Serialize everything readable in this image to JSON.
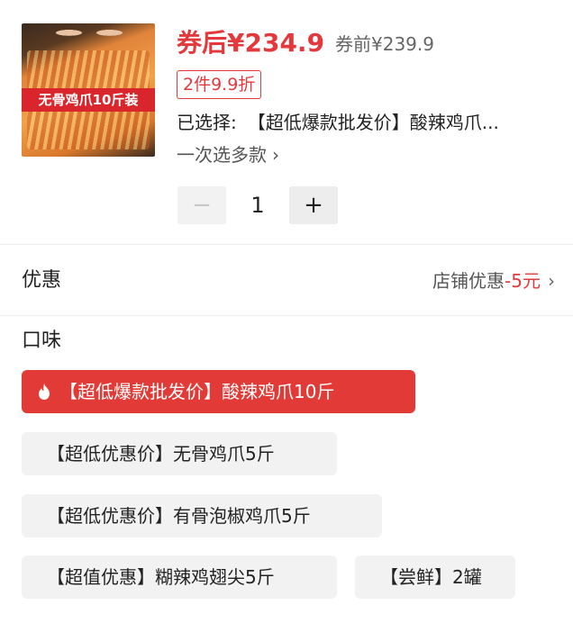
{
  "product": {
    "image_caption": "无骨鸡爪10斤装",
    "price_after": "券后¥234.9",
    "price_before": "券前¥239.9",
    "promo_tag": "2件9.9折",
    "selected_label": "已选择:",
    "selected_value": "【超低爆款批发价】酸辣鸡爪...",
    "multi_select": "一次选多款",
    "multi_chevron": "›"
  },
  "quantity": {
    "minus": "−",
    "value": "1",
    "plus": "+"
  },
  "discount": {
    "label": "优惠",
    "store_label": "店铺优惠",
    "amount": "-5元",
    "chevron": "›"
  },
  "flavor": {
    "label": "口味",
    "options": [
      {
        "label": "【超低爆款批发价】酸辣鸡爪10斤",
        "selected": true
      },
      {
        "label": "【超低优惠价】无骨鸡爪5斤",
        "selected": false
      },
      {
        "label": "【超低优惠价】有骨泡椒鸡爪5斤",
        "selected": false
      },
      {
        "label": "【超值优惠】糊辣鸡翅尖5斤",
        "selected": false
      },
      {
        "label": "【尝鲜】2罐",
        "selected": false
      }
    ]
  },
  "colors": {
    "accent": "#e4393c",
    "chip_active": "#e23a36",
    "chip_bg": "#f2f2f2"
  }
}
